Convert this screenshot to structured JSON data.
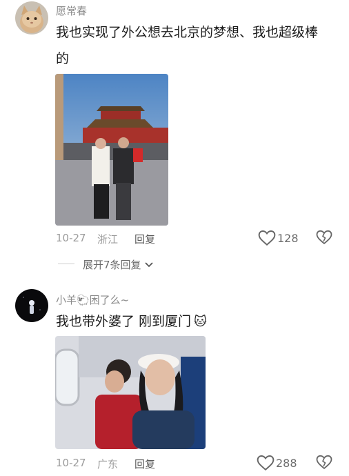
{
  "comments": [
    {
      "username": "愿常春",
      "text_line1": "我也实现了外公想去北京的梦想、我也超级棒",
      "text_line2": "的",
      "date": "10-27",
      "location": "浙江",
      "reply_label": "回复",
      "likes": "128"
    },
    {
      "username": "小羊🐑困了么~",
      "text": "我也带外婆了 刚到厦门",
      "emoji": "🐱",
      "date": "10-27",
      "location": "广东",
      "reply_label": "回复",
      "likes": "288"
    }
  ],
  "expand_replies": {
    "label": "展开7条回复"
  }
}
